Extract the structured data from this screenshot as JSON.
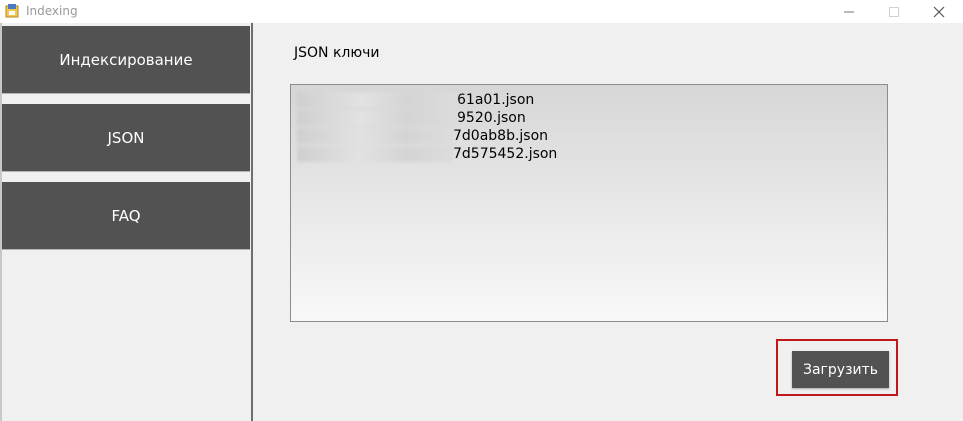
{
  "window": {
    "title": "Indexing"
  },
  "sidebar": {
    "items": [
      {
        "label": "Индексирование"
      },
      {
        "label": "JSON"
      },
      {
        "label": "FAQ"
      }
    ]
  },
  "main": {
    "section_label": "JSON ключи",
    "json_files": [
      {
        "visible_suffix": "61a01.json"
      },
      {
        "visible_suffix": "9520.json"
      },
      {
        "visible_suffix": "7d0ab8b.json"
      },
      {
        "visible_suffix": "7d575452.json"
      }
    ],
    "upload_label": "Загрузить"
  },
  "colors": {
    "nav_button_bg": "#525252",
    "highlight_frame": "#c01818",
    "window_bg": "#f0f0f0"
  },
  "icons": {
    "app": "app-icon",
    "minimize": "minimize-icon",
    "maximize": "maximize-icon",
    "close": "close-icon"
  }
}
